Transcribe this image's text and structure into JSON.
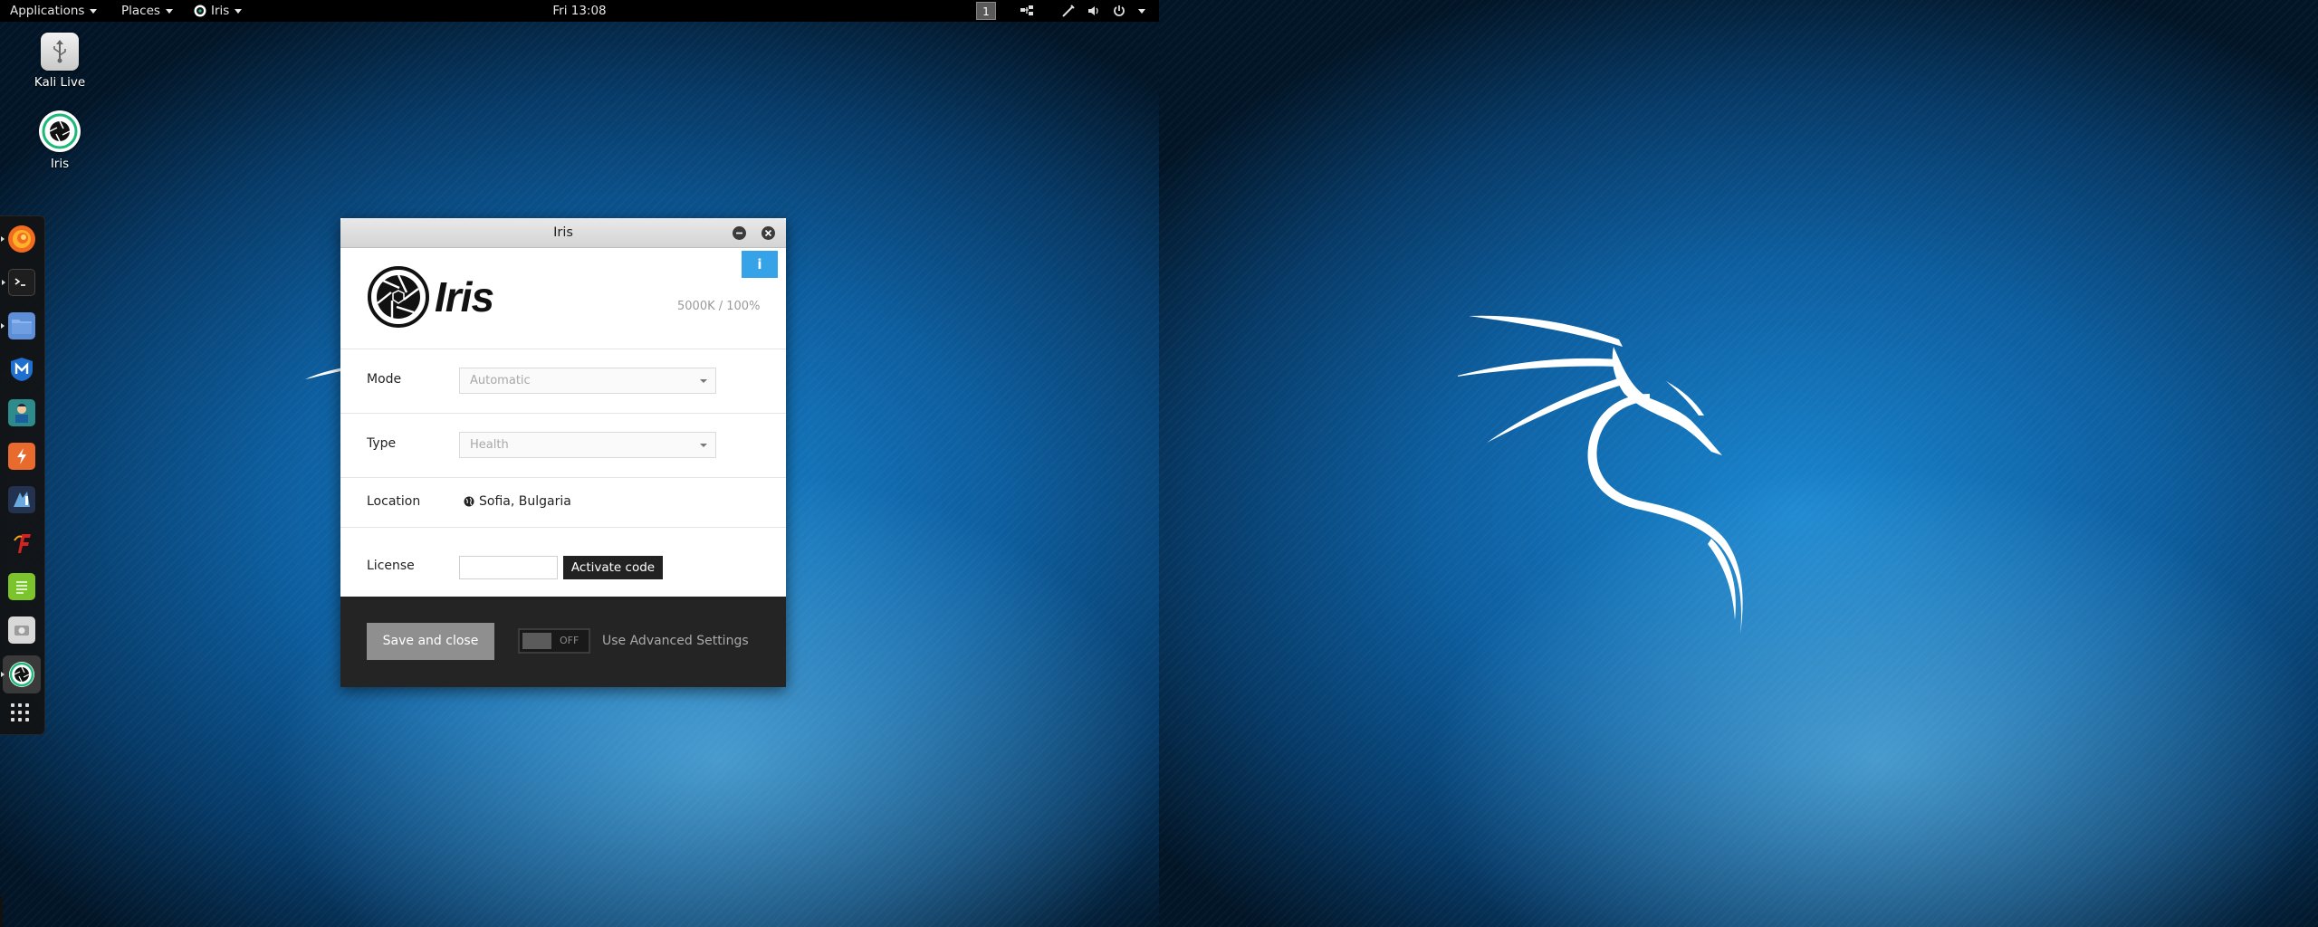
{
  "top_panel": {
    "applications_label": "Applications",
    "places_label": "Places",
    "app_menu_label": "Iris",
    "clock": "Fri 13:08",
    "workspace_number": "1",
    "tray_icons": [
      "workspace-indicator",
      "network-icon",
      "tool-icon",
      "volume-icon",
      "power-icon"
    ]
  },
  "desktop": {
    "icons": [
      {
        "label": "Kali Live",
        "icon": "usb-drive-icon"
      },
      {
        "label": "Iris",
        "icon": "iris-app-icon"
      }
    ]
  },
  "dock": {
    "items": [
      {
        "name": "firefox",
        "color": "#f26c1f"
      },
      {
        "name": "terminal",
        "color": "#1e1e1e"
      },
      {
        "name": "file-manager",
        "color": "#5d8fd8"
      },
      {
        "name": "metasploit",
        "color": "#1f6fd1"
      },
      {
        "name": "armitage",
        "color": "#2e8b8b"
      },
      {
        "name": "burpsuite",
        "color": "#e86a2c"
      },
      {
        "name": "beef",
        "color": "#22324f"
      },
      {
        "name": "faraday",
        "color": "#d32222"
      },
      {
        "name": "text-editor",
        "color": "#7bc42b"
      },
      {
        "name": "screenshot",
        "color": "#d8d8d8"
      },
      {
        "name": "iris",
        "color": "#ffffff"
      }
    ],
    "show_apps_icon": "grid-icon"
  },
  "iris_window": {
    "title": "Iris",
    "info_label": "i",
    "logo_text": "Iris",
    "stats": "5000K / 100%",
    "mode": {
      "label": "Mode",
      "value": "Automatic"
    },
    "type": {
      "label": "Type",
      "value": "Health"
    },
    "location": {
      "label": "Location",
      "value": "Sofia, Bulgaria"
    },
    "license": {
      "label": "License",
      "input_value": "",
      "button_label": "Activate code"
    },
    "footer": {
      "save_label": "Save and close",
      "toggle_state": "OFF",
      "advanced_label": "Use Advanced Settings"
    }
  },
  "colors": {
    "accent_blue": "#36a3e8",
    "footer_bg": "#242424",
    "save_button": "#8f8f8f"
  }
}
